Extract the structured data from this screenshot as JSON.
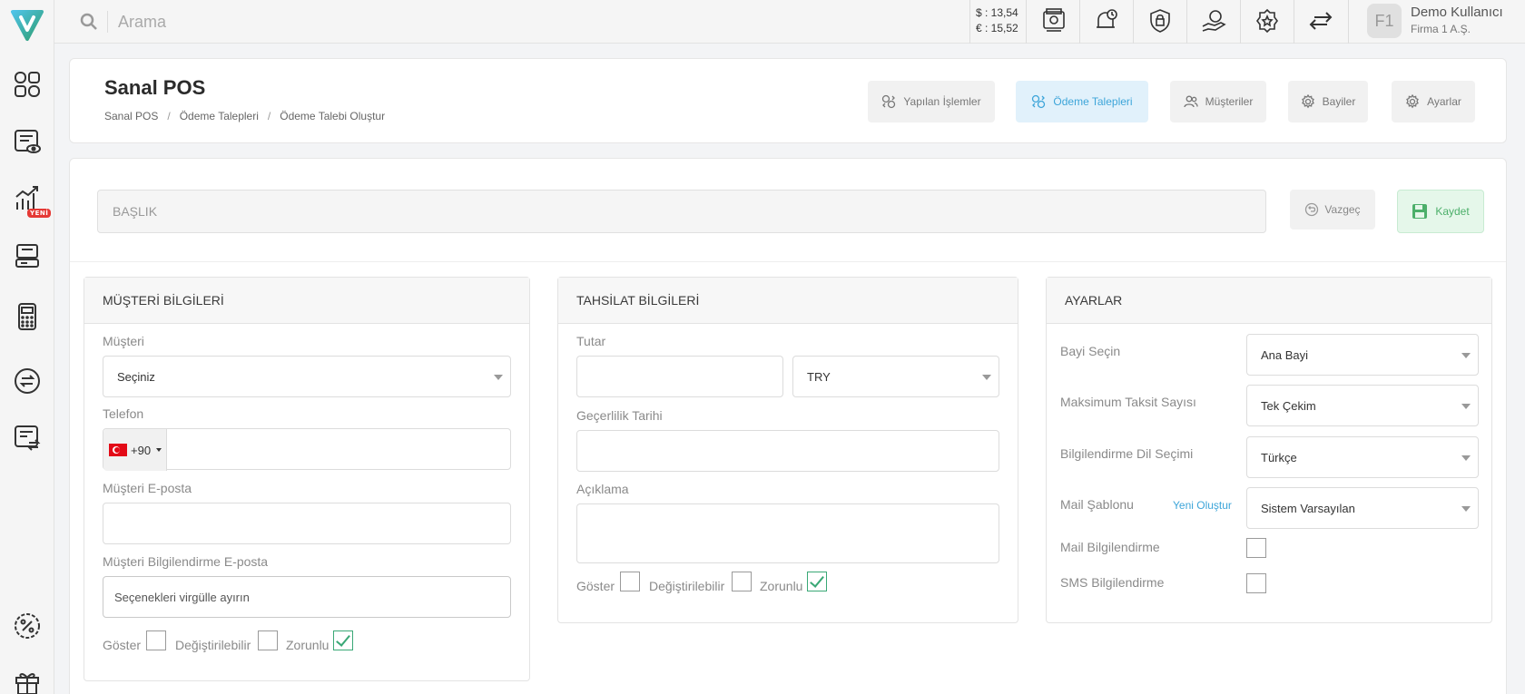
{
  "colors": {
    "accent": "#3da5d9",
    "save_green": "#4caf6a",
    "check_green": "#3aa876",
    "badge_red": "#e53935"
  },
  "sidebar": {
    "badge": "YENİ",
    "icons": [
      "dashboard-icon",
      "list-view-icon",
      "chart-icon",
      "pos-device-icon",
      "calculator-icon",
      "exchange-icon",
      "transfer-list-icon",
      "discount-icon",
      "gift-icon"
    ]
  },
  "topbar": {
    "search_placeholder": "Arama",
    "usd": "$ : 13,54",
    "eur": "€ : 15,52",
    "user_initials": "F1",
    "user_name": "Demo Kullanıcı",
    "user_company": "Firma 1 A.Ş."
  },
  "header": {
    "title": "Sanal POS",
    "breadcrumb": [
      "Sanal POS",
      "Ödeme Talepleri",
      "Ödeme Talebi Oluştur"
    ],
    "breadcrumb_sep": "/",
    "buttons": [
      "Yapılan İşlemler",
      "Ödeme Talepleri",
      "Müşteriler",
      "Bayiler",
      "Ayarlar"
    ]
  },
  "form": {
    "title_placeholder": "BAŞLIK",
    "cancel": "Vazgeç",
    "save": "Kaydet"
  },
  "customer": {
    "heading": "MÜŞTERİ BİLGİLERİ",
    "customer_label": "Müşteri",
    "customer_value": "Seçiniz",
    "phone_label": "Telefon",
    "phone_code": "+90",
    "email_label": "Müşteri E-posta",
    "notify_email_label": "Müşteri Bilgilendirme E-posta",
    "notify_email_placeholder": "Seçenekleri virgülle ayırın",
    "chk_show": "Göster",
    "chk_editable": "Değiştirilebilir",
    "chk_required": "Zorunlu"
  },
  "collection": {
    "heading": "TAHSİLAT BİLGİLERİ",
    "amount_label": "Tutar",
    "currency_value": "TRY",
    "validity_label": "Geçerlilik Tarihi",
    "description_label": "Açıklama",
    "chk_show": "Göster",
    "chk_editable": "Değiştirilebilir",
    "chk_required": "Zorunlu"
  },
  "settings": {
    "heading": "AYARLAR",
    "dealer_label": "Bayi Seçin",
    "dealer_value": "Ana Bayi",
    "installment_label": "Maksimum Taksit Sayısı",
    "installment_value": "Tek Çekim",
    "language_label": "Bilgilendirme Dil Seçimi",
    "language_value": "Türkçe",
    "template_label": "Mail Şablonu",
    "template_link": "Yeni Oluştur",
    "template_value": "Sistem Varsayılan",
    "mail_notify_label": "Mail Bilgilendirme",
    "sms_notify_label": "SMS Bilgilendirme"
  }
}
